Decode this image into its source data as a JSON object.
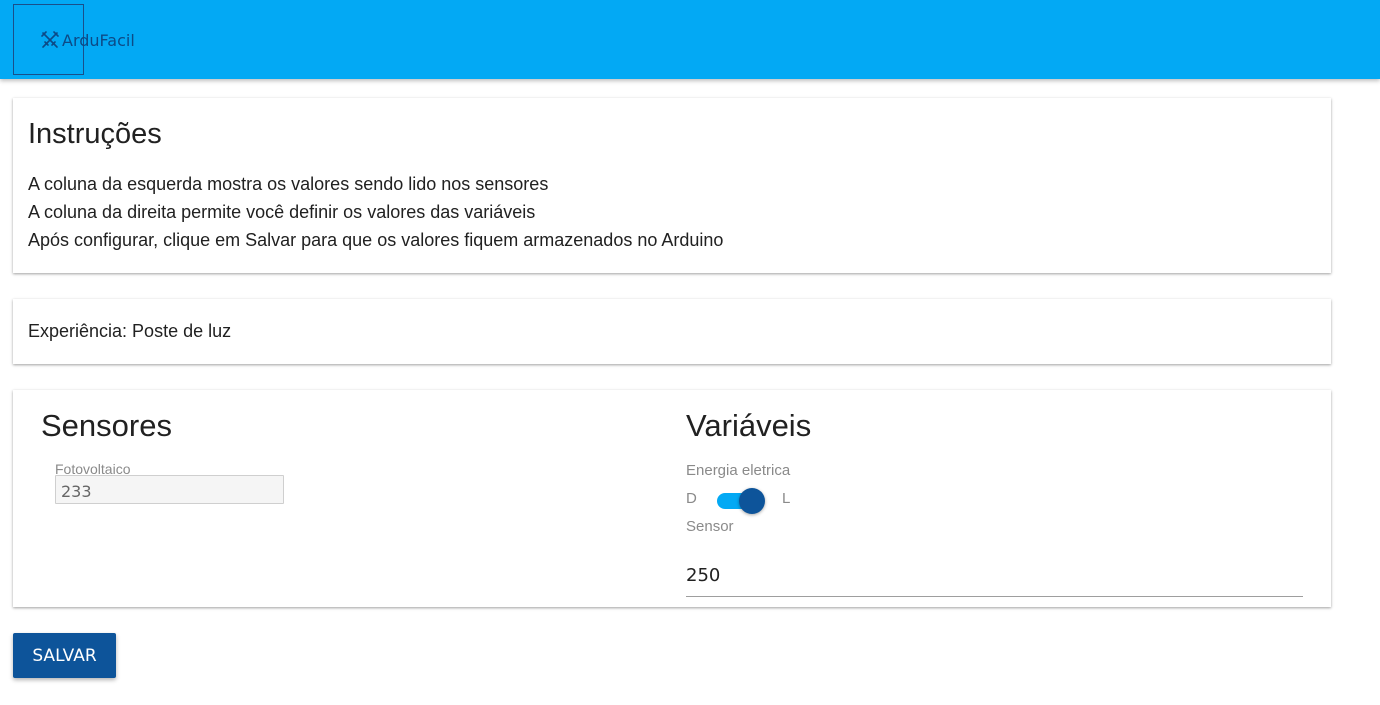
{
  "app": {
    "logo_text": "ArduFacil",
    "logo_icon": "crossed-tools-icon"
  },
  "instructions": {
    "title": "Instruções",
    "lines": [
      "A coluna da esquerda mostra os valores sendo lido nos sensores",
      "A coluna da direita permite você definir os valores das variáveis",
      "Após configurar, clique em Salvar para que os valores fiquem armazenados no Arduino"
    ]
  },
  "experiment": {
    "text": "Experiência: Poste de luz"
  },
  "sensors": {
    "title": "Sensores",
    "items": [
      {
        "label": "Fotovoltaico",
        "value": "233"
      }
    ]
  },
  "variables": {
    "title": "Variáveis",
    "toggle": {
      "label": "Energia eletrica",
      "off_label": "D",
      "on_label": "L",
      "checked": true
    },
    "sensor": {
      "label": "Sensor",
      "value": "250"
    }
  },
  "actions": {
    "save_label": "Salvar"
  },
  "colors": {
    "header": "#03a9f4",
    "primary": "#0d549a"
  }
}
